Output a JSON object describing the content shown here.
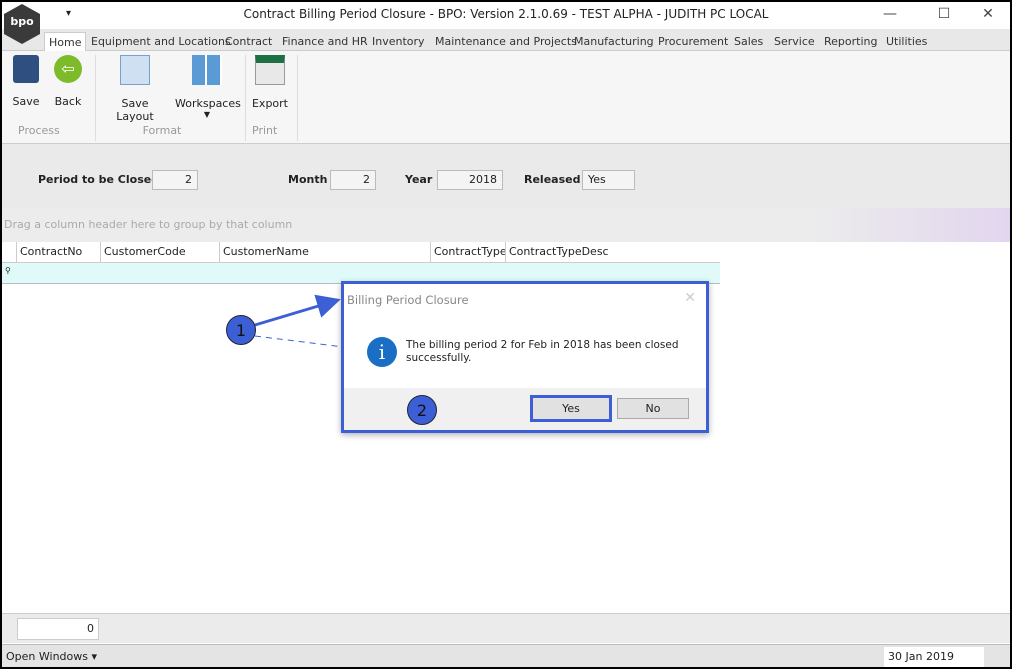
{
  "window": {
    "title": "Contract Billing Period Closure - BPO: Version 2.1.0.69 - TEST ALPHA - JUDITH PC LOCAL",
    "logo_text": "bpo",
    "qat": "▾",
    "min": "—",
    "max": "☐",
    "close": "✕"
  },
  "tabs": [
    {
      "label": "Home"
    },
    {
      "label": "Equipment and Locations"
    },
    {
      "label": "Contract"
    },
    {
      "label": "Finance and HR"
    },
    {
      "label": "Inventory"
    },
    {
      "label": "Maintenance and Projects"
    },
    {
      "label": "Manufacturing"
    },
    {
      "label": "Procurement"
    },
    {
      "label": "Sales"
    },
    {
      "label": "Service"
    },
    {
      "label": "Reporting"
    },
    {
      "label": "Utilities"
    }
  ],
  "ribbon": {
    "save": "Save",
    "back": "Back",
    "save_layout": "Save Layout",
    "workspaces": "Workspaces",
    "export": "Export",
    "groups": {
      "process": "Process",
      "format": "Format",
      "print": "Print"
    }
  },
  "filter": {
    "period_label": "Period to be Closed",
    "period": "2",
    "month_label": "Month",
    "month": "2",
    "year_label": "Year",
    "year": "2018",
    "released_label": "Released",
    "released": "Yes"
  },
  "grid": {
    "group_hint": "Drag a column header here to group by that column",
    "columns": [
      "ContractNo",
      "CustomerCode",
      "CustomerName",
      "ContractType",
      "ContractTypeDesc"
    ]
  },
  "dialog": {
    "title": "Billing Period Closure",
    "message": "The billing period 2 for Feb in 2018 has been closed successfully.",
    "yes": "Yes",
    "no": "No"
  },
  "callouts": {
    "one": "1",
    "two": "2"
  },
  "footer": {
    "count": "0",
    "open_windows": "Open Windows ▾",
    "date": "30 Jan 2019"
  }
}
